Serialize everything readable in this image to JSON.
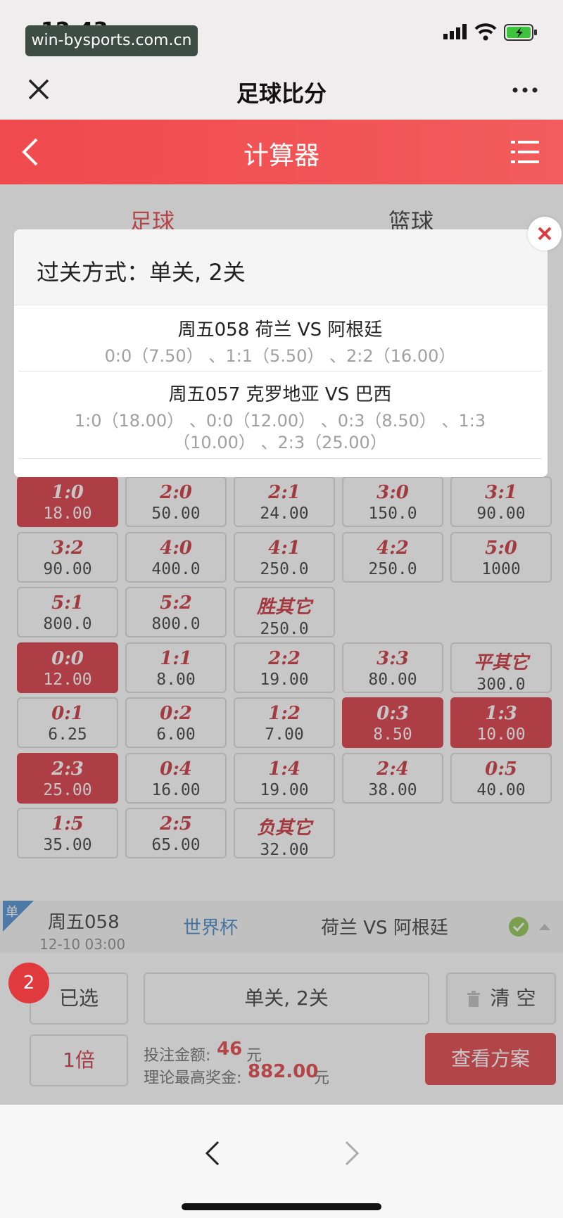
{
  "status_bar": {
    "time": "12:43",
    "watermark": "win-bysports.com.cn"
  },
  "browser": {
    "title": "足球比分"
  },
  "app": {
    "title": "计算器",
    "accent_color": "#f04a4d"
  },
  "sport_tabs": [
    {
      "label": "足球",
      "active": true
    },
    {
      "label": "篮球",
      "active": false
    }
  ],
  "odds_grid": [
    [
      {
        "score": "1:0",
        "odds": "18.00",
        "selected": true
      },
      {
        "score": "2:0",
        "odds": "50.00",
        "selected": false
      },
      {
        "score": "2:1",
        "odds": "24.00",
        "selected": false
      },
      {
        "score": "3:0",
        "odds": "150.0",
        "selected": false
      },
      {
        "score": "3:1",
        "odds": "90.00",
        "selected": false
      }
    ],
    [
      {
        "score": "3:2",
        "odds": "90.00",
        "selected": false
      },
      {
        "score": "4:0",
        "odds": "400.0",
        "selected": false
      },
      {
        "score": "4:1",
        "odds": "250.0",
        "selected": false
      },
      {
        "score": "4:2",
        "odds": "250.0",
        "selected": false
      },
      {
        "score": "5:0",
        "odds": "1000",
        "selected": false
      }
    ],
    [
      {
        "score": "5:1",
        "odds": "800.0",
        "selected": false
      },
      {
        "score": "5:2",
        "odds": "800.0",
        "selected": false
      },
      {
        "score": "胜其它",
        "odds": "250.0",
        "selected": false
      }
    ],
    [
      {
        "score": "0:0",
        "odds": "12.00",
        "selected": true
      },
      {
        "score": "1:1",
        "odds": "8.00",
        "selected": false
      },
      {
        "score": "2:2",
        "odds": "19.00",
        "selected": false
      },
      {
        "score": "3:3",
        "odds": "80.00",
        "selected": false
      },
      {
        "score": "平其它",
        "odds": "300.0",
        "selected": false
      }
    ],
    [
      {
        "score": "0:1",
        "odds": "6.25",
        "selected": false
      },
      {
        "score": "0:2",
        "odds": "6.00",
        "selected": false
      },
      {
        "score": "1:2",
        "odds": "7.00",
        "selected": false
      },
      {
        "score": "0:3",
        "odds": "8.50",
        "selected": true
      },
      {
        "score": "1:3",
        "odds": "10.00",
        "selected": true
      }
    ],
    [
      {
        "score": "2:3",
        "odds": "25.00",
        "selected": true
      },
      {
        "score": "0:4",
        "odds": "16.00",
        "selected": false
      },
      {
        "score": "1:4",
        "odds": "19.00",
        "selected": false
      },
      {
        "score": "2:4",
        "odds": "38.00",
        "selected": false
      },
      {
        "score": "0:5",
        "odds": "40.00",
        "selected": false
      }
    ],
    [
      {
        "score": "1:5",
        "odds": "35.00",
        "selected": false
      },
      {
        "score": "2:5",
        "odds": "65.00",
        "selected": false
      },
      {
        "score": "负其它",
        "odds": "32.00",
        "selected": false
      }
    ]
  ],
  "match_row": {
    "badge": "单",
    "day": "周五058",
    "time": "12-10 03:00",
    "league": "世界杯",
    "teams": "荷兰 VS 阿根廷"
  },
  "bottom_bar": {
    "selected_count": "2",
    "selected_label": "已选",
    "pass_type": "单关, 2关",
    "clear_label": "清 空",
    "multiplier": "1倍",
    "bet_amount_label": "投注金额:",
    "bet_amount": "46",
    "unit": "元",
    "max_prize_label": "理论最高奖金:",
    "max_prize": "882.00",
    "view_plan": "查看方案"
  },
  "modal": {
    "title": "过关方式：单关, 2关",
    "matches": [
      {
        "title": "周五058 荷兰 VS 阿根廷",
        "picks": "0:0（7.50） 、1:1（5.50） 、2:2（16.00）"
      },
      {
        "title": "周五057 克罗地亚 VS 巴西",
        "picks": "1:0（18.00） 、0:0（12.00） 、0:3（8.50） 、1:3（10.00） 、2:3（25.00）"
      }
    ]
  }
}
